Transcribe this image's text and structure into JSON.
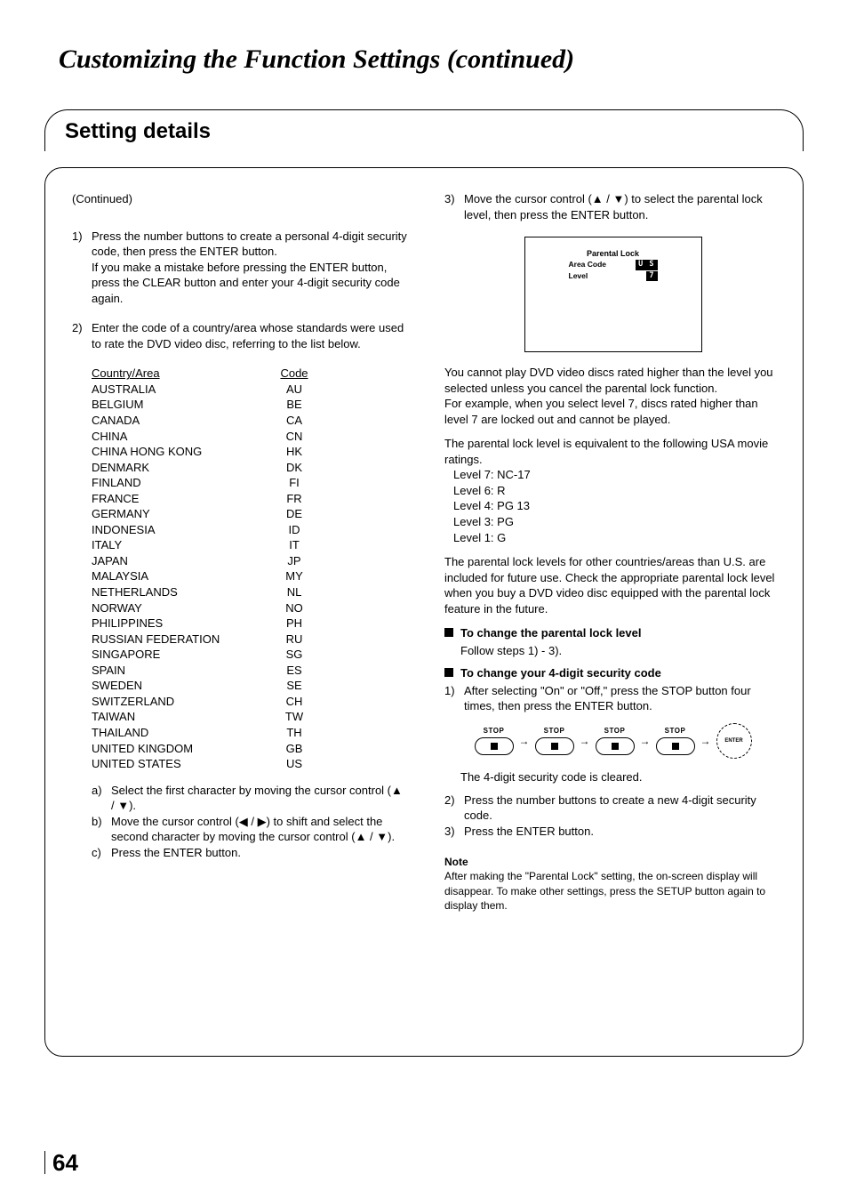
{
  "page_number": "64",
  "chapter_title": "Customizing the Function Settings (continued)",
  "subheading": "Setting details",
  "left": {
    "continued": "(Continued)",
    "step1_num": "1)",
    "step1_a": "Press the number buttons to create a personal 4-digit security code, then press the ENTER button.",
    "step1_b": "If you make a mistake before pressing the ENTER button, press the CLEAR button and enter your 4-digit security code again.",
    "step2_num": "2)",
    "step2": "Enter the code of a country/area whose standards were used to rate the DVD video disc, referring to the list below.",
    "cc_header_a": "Country/Area",
    "cc_header_b": "Code",
    "countries": [
      {
        "ca": "AUSTRALIA",
        "cd": "AU"
      },
      {
        "ca": "BELGIUM",
        "cd": "BE"
      },
      {
        "ca": "CANADA",
        "cd": "CA"
      },
      {
        "ca": "CHINA",
        "cd": "CN"
      },
      {
        "ca": "CHINA HONG KONG",
        "cd": "HK"
      },
      {
        "ca": "DENMARK",
        "cd": "DK"
      },
      {
        "ca": "FINLAND",
        "cd": "FI"
      },
      {
        "ca": "FRANCE",
        "cd": "FR"
      },
      {
        "ca": "GERMANY",
        "cd": "DE"
      },
      {
        "ca": "INDONESIA",
        "cd": "ID"
      },
      {
        "ca": "ITALY",
        "cd": "IT"
      },
      {
        "ca": "JAPAN",
        "cd": "JP"
      },
      {
        "ca": "MALAYSIA",
        "cd": "MY"
      },
      {
        "ca": "NETHERLANDS",
        "cd": "NL"
      },
      {
        "ca": "NORWAY",
        "cd": "NO"
      },
      {
        "ca": "PHILIPPINES",
        "cd": "PH"
      },
      {
        "ca": "RUSSIAN FEDERATION",
        "cd": "RU"
      },
      {
        "ca": "SINGAPORE",
        "cd": "SG"
      },
      {
        "ca": "SPAIN",
        "cd": "ES"
      },
      {
        "ca": "SWEDEN",
        "cd": "SE"
      },
      {
        "ca": "SWITZERLAND",
        "cd": "CH"
      },
      {
        "ca": "TAIWAN",
        "cd": "TW"
      },
      {
        "ca": "THAILAND",
        "cd": "TH"
      },
      {
        "ca": "UNITED KINGDOM",
        "cd": "GB"
      },
      {
        "ca": "UNITED STATES",
        "cd": "US"
      }
    ],
    "sub_a_num": "a)",
    "sub_a": "Select the first character by moving the cursor control (▲ / ▼).",
    "sub_b_num": "b)",
    "sub_b": "Move the cursor control (◀ / ▶) to shift and select the second character by moving the cursor control (▲ / ▼).",
    "sub_c_num": "c)",
    "sub_c": "Press the ENTER button."
  },
  "right": {
    "step3_num": "3)",
    "step3": "Move the cursor control (▲ / ▼) to select the parental lock level, then press the ENTER button.",
    "osd_title": "Parental Lock",
    "osd_area_label": "Area Code",
    "osd_area_val": "U S",
    "osd_level_label": "Level",
    "osd_level_val": "7",
    "p1a": "You cannot play DVD video discs rated higher than the level you selected unless you cancel the parental lock function.",
    "p1b": "For example, when you select level 7, discs rated higher than level 7 are locked out and cannot be played.",
    "p2": "The parental lock level is equivalent to the following USA movie ratings.",
    "levels": [
      "Level 7: NC-17",
      "Level 6: R",
      "Level 4: PG 13",
      "Level 3: PG",
      "Level 1: G"
    ],
    "p3": "The parental lock levels for other countries/areas than U.S. are included for future use. Check the appropriate parental lock level when you buy a DVD video disc equipped with the parental lock feature in the future.",
    "b1_title": "To change the parental lock level",
    "b1_body": "Follow steps 1) - 3).",
    "b2_title": "To change your 4-digit security code",
    "b2_s1_num": "1)",
    "b2_s1": "After selecting \"On\" or \"Off,\" press the STOP button four times, then press the ENTER button.",
    "stop_label": "STOP",
    "enter_label": "ENTER",
    "b2_cleared": "The 4-digit security code is cleared.",
    "b2_s2_num": "2)",
    "b2_s2": "Press the number buttons to create a new 4-digit security code.",
    "b2_s3_num": "3)",
    "b2_s3": "Press the ENTER button.",
    "note_head": "Note",
    "note_body": "After making the \"Parental Lock\" setting, the on-screen display will disappear. To make other settings, press the SETUP button again to display them."
  }
}
